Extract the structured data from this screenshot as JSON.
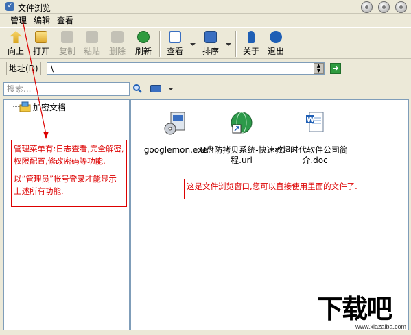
{
  "window": {
    "title": "文件浏览"
  },
  "menu": {
    "items": [
      "管理",
      "编辑",
      "查看"
    ]
  },
  "toolbar": {
    "up": "向上",
    "open": "打开",
    "copy": "复制",
    "paste": "粘贴",
    "delete": "删除",
    "refresh": "刷新",
    "view": "查看",
    "sort": "排序",
    "about": "关于",
    "exit": "退出"
  },
  "address": {
    "label": "地址(D)",
    "value": "\\"
  },
  "search": {
    "placeholder": "搜索..."
  },
  "tree": {
    "root_label": "加密文档"
  },
  "files": [
    {
      "name": "googlemon.exe",
      "icon": "exe-installer-icon"
    },
    {
      "name": "U盘防拷贝系统-快速教程.url",
      "icon": "url-globe-icon"
    },
    {
      "name": "超时代软件公司简介.doc",
      "icon": "word-doc-icon"
    }
  ],
  "annotations": {
    "menu_note_1": "管理菜单有:日志查看,完全解密,权限配置,修改密码等功能.",
    "menu_note_2": "以“管理员”帐号登录才能显示上述所有功能.",
    "window_note": "这是文件浏览窗口,您可以直接使用里面的文件了."
  },
  "watermark": {
    "logo": "下载吧",
    "url": "www.xiazaiba.com"
  },
  "colors": {
    "annotation_red": "#dd0000",
    "pane_border": "#7f9db9",
    "chrome": "#ece9d8"
  }
}
